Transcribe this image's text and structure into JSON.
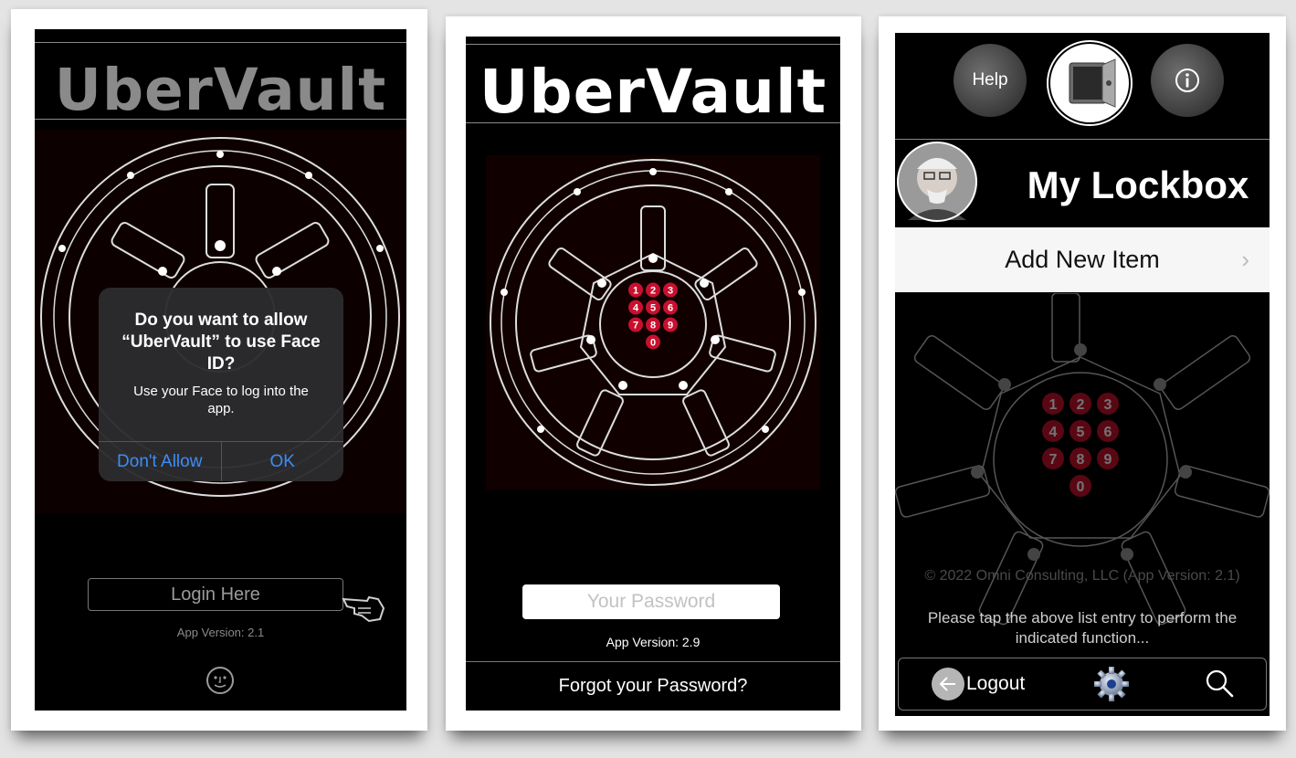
{
  "screen1": {
    "logo": "UberVault",
    "dialog": {
      "title": "Do you want to allow “UberVault” to use Face ID?",
      "message": "Use your Face to log into the app.",
      "deny_label": "Don't Allow",
      "ok_label": "OK"
    },
    "login_label": "Login Here",
    "version": "App Version: 2.1"
  },
  "screen2": {
    "logo": "UberVault",
    "password_placeholder": "Your Password",
    "version": "App Version: 2.9",
    "forgot_label": "Forgot your Password?"
  },
  "screen3": {
    "help_label": "Help",
    "title": "My Lockbox",
    "add_item_label": "Add New Item",
    "copyright": "© 2022 Omni Consulting, LLC (App Version: 2.1)",
    "instruction": "Please tap the above list entry to perform the indicated function...",
    "logout_label": "Logout"
  },
  "keypad": [
    "1",
    "2",
    "3",
    "4",
    "5",
    "6",
    "7",
    "8",
    "9",
    "0"
  ],
  "colors": {
    "keypad": "#c8102e",
    "alert_button": "#3d8cf5",
    "background": "#000000"
  }
}
